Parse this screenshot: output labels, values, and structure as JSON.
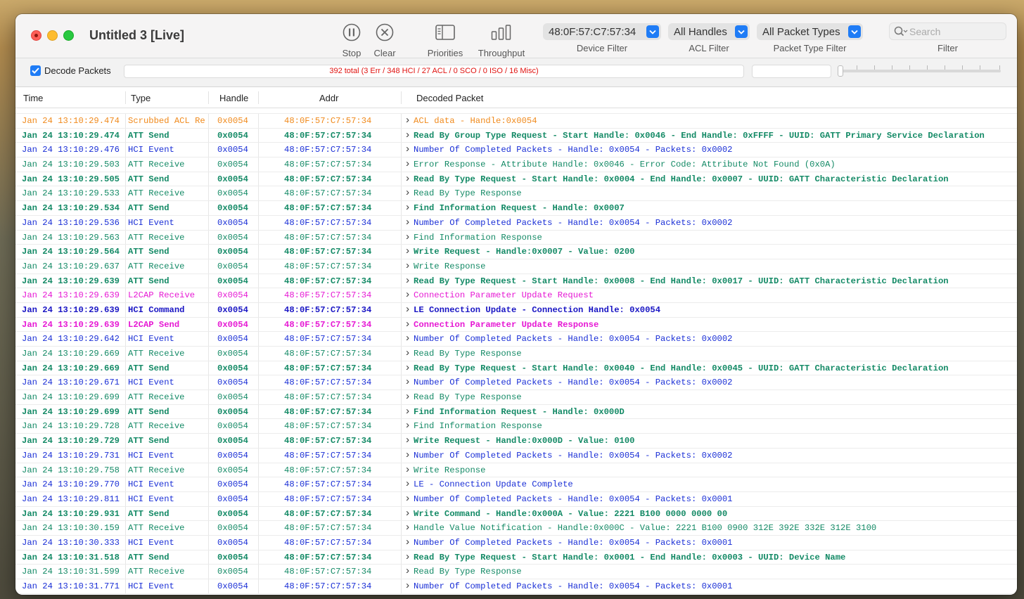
{
  "window": {
    "title": "Untitled 3 [Live]"
  },
  "toolbar": {
    "stop_label": "Stop",
    "clear_label": "Clear",
    "priorities_label": "Priorities",
    "throughput_label": "Throughput",
    "device_filter_value": "48:0F:57:C7:57:34",
    "device_filter_label": "Device Filter",
    "acl_filter_value": "All Handles",
    "acl_filter_label": "ACL Filter",
    "packet_type_value": "All Packet Types",
    "packet_type_label": "Packet Type Filter",
    "search_placeholder": "Search",
    "filter_label": "Filter"
  },
  "filterbar": {
    "decode_label": "Decode Packets",
    "decode_checked": true,
    "summary": "392 total (3 Err / 348 HCI / 27 ACL / 0 SCO / 0 ISO / 16 Misc)"
  },
  "columns": {
    "time": "Time",
    "type": "Type",
    "handle": "Handle",
    "addr": "Addr",
    "decoded": "Decoded Packet"
  },
  "colors": {
    "green": "#148a66",
    "blue": "#1a2fd6",
    "orange": "#f08a1c",
    "magenta": "#e619d4",
    "navy": "#1a16c4",
    "red": "#e0120f"
  },
  "rows": [
    {
      "time": "Jan 24 13:10:29.474",
      "type": "Scrubbed ACL Re",
      "handle": "0x0054",
      "addr": "48:0F:57:C7:57:34",
      "decoded": "ACL data - Handle:0x0054",
      "color": "orange",
      "bold": false
    },
    {
      "time": "Jan 24 13:10:29.474",
      "type": "ATT Send",
      "handle": "0x0054",
      "addr": "48:0F:57:C7:57:34",
      "decoded": "Read By Group Type Request - Start Handle: 0x0046 - End Handle: 0xFFFF - UUID: GATT Primary Service Declaration",
      "color": "green",
      "bold": true
    },
    {
      "time": "Jan 24 13:10:29.476",
      "type": "HCI Event",
      "handle": "0x0054",
      "addr": "48:0F:57:C7:57:34",
      "decoded": "Number Of Completed Packets - Handle: 0x0054 - Packets: 0x0002",
      "color": "blue",
      "bold": false
    },
    {
      "time": "Jan 24 13:10:29.503",
      "type": "ATT Receive",
      "handle": "0x0054",
      "addr": "48:0F:57:C7:57:34",
      "decoded": "Error Response - Attribute Handle: 0x0046 - Error Code: Attribute Not Found (0x0A)",
      "color": "green",
      "bold": false
    },
    {
      "time": "Jan 24 13:10:29.505",
      "type": "ATT Send",
      "handle": "0x0054",
      "addr": "48:0F:57:C7:57:34",
      "decoded": "Read By Type Request - Start Handle: 0x0004 - End Handle: 0x0007 - UUID: GATT Characteristic Declaration",
      "color": "green",
      "bold": true
    },
    {
      "time": "Jan 24 13:10:29.533",
      "type": "ATT Receive",
      "handle": "0x0054",
      "addr": "48:0F:57:C7:57:34",
      "decoded": "Read By Type Response",
      "color": "green",
      "bold": false
    },
    {
      "time": "Jan 24 13:10:29.534",
      "type": "ATT Send",
      "handle": "0x0054",
      "addr": "48:0F:57:C7:57:34",
      "decoded": "Find Information Request - Handle: 0x0007",
      "color": "green",
      "bold": true
    },
    {
      "time": "Jan 24 13:10:29.536",
      "type": "HCI Event",
      "handle": "0x0054",
      "addr": "48:0F:57:C7:57:34",
      "decoded": "Number Of Completed Packets - Handle: 0x0054 - Packets: 0x0002",
      "color": "blue",
      "bold": false
    },
    {
      "time": "Jan 24 13:10:29.563",
      "type": "ATT Receive",
      "handle": "0x0054",
      "addr": "48:0F:57:C7:57:34",
      "decoded": "Find Information Response",
      "color": "green",
      "bold": false
    },
    {
      "time": "Jan 24 13:10:29.564",
      "type": "ATT Send",
      "handle": "0x0054",
      "addr": "48:0F:57:C7:57:34",
      "decoded": "Write Request - Handle:0x0007 - Value: 0200",
      "color": "green",
      "bold": true
    },
    {
      "time": "Jan 24 13:10:29.637",
      "type": "ATT Receive",
      "handle": "0x0054",
      "addr": "48:0F:57:C7:57:34",
      "decoded": "Write Response",
      "color": "green",
      "bold": false
    },
    {
      "time": "Jan 24 13:10:29.639",
      "type": "ATT Send",
      "handle": "0x0054",
      "addr": "48:0F:57:C7:57:34",
      "decoded": "Read By Type Request - Start Handle: 0x0008 - End Handle: 0x0017 - UUID: GATT Characteristic Declaration",
      "color": "green",
      "bold": true
    },
    {
      "time": "Jan 24 13:10:29.639",
      "type": "L2CAP Receive",
      "handle": "0x0054",
      "addr": "48:0F:57:C7:57:34",
      "decoded": "Connection Parameter Update Request",
      "color": "magenta",
      "bold": false
    },
    {
      "time": "Jan 24 13:10:29.639",
      "type": "HCI Command",
      "handle": "0x0054",
      "addr": "48:0F:57:C7:57:34",
      "decoded": "LE Connection Update - Connection Handle: 0x0054",
      "color": "navy",
      "bold": true
    },
    {
      "time": "Jan 24 13:10:29.639",
      "type": "L2CAP Send",
      "handle": "0x0054",
      "addr": "48:0F:57:C7:57:34",
      "decoded": "Connection Parameter Update Response",
      "color": "magenta",
      "bold": true
    },
    {
      "time": "Jan 24 13:10:29.642",
      "type": "HCI Event",
      "handle": "0x0054",
      "addr": "48:0F:57:C7:57:34",
      "decoded": "Number Of Completed Packets - Handle: 0x0054 - Packets: 0x0002",
      "color": "blue",
      "bold": false
    },
    {
      "time": "Jan 24 13:10:29.669",
      "type": "ATT Receive",
      "handle": "0x0054",
      "addr": "48:0F:57:C7:57:34",
      "decoded": "Read By Type Response",
      "color": "green",
      "bold": false
    },
    {
      "time": "Jan 24 13:10:29.669",
      "type": "ATT Send",
      "handle": "0x0054",
      "addr": "48:0F:57:C7:57:34",
      "decoded": "Read By Type Request - Start Handle: 0x0040 - End Handle: 0x0045 - UUID: GATT Characteristic Declaration",
      "color": "green",
      "bold": true
    },
    {
      "time": "Jan 24 13:10:29.671",
      "type": "HCI Event",
      "handle": "0x0054",
      "addr": "48:0F:57:C7:57:34",
      "decoded": "Number Of Completed Packets - Handle: 0x0054 - Packets: 0x0002",
      "color": "blue",
      "bold": false
    },
    {
      "time": "Jan 24 13:10:29.699",
      "type": "ATT Receive",
      "handle": "0x0054",
      "addr": "48:0F:57:C7:57:34",
      "decoded": "Read By Type Response",
      "color": "green",
      "bold": false
    },
    {
      "time": "Jan 24 13:10:29.699",
      "type": "ATT Send",
      "handle": "0x0054",
      "addr": "48:0F:57:C7:57:34",
      "decoded": "Find Information Request - Handle: 0x000D",
      "color": "green",
      "bold": true
    },
    {
      "time": "Jan 24 13:10:29.728",
      "type": "ATT Receive",
      "handle": "0x0054",
      "addr": "48:0F:57:C7:57:34",
      "decoded": "Find Information Response",
      "color": "green",
      "bold": false
    },
    {
      "time": "Jan 24 13:10:29.729",
      "type": "ATT Send",
      "handle": "0x0054",
      "addr": "48:0F:57:C7:57:34",
      "decoded": "Write Request - Handle:0x000D - Value: 0100",
      "color": "green",
      "bold": true
    },
    {
      "time": "Jan 24 13:10:29.731",
      "type": "HCI Event",
      "handle": "0x0054",
      "addr": "48:0F:57:C7:57:34",
      "decoded": "Number Of Completed Packets - Handle: 0x0054 - Packets: 0x0002",
      "color": "blue",
      "bold": false
    },
    {
      "time": "Jan 24 13:10:29.758",
      "type": "ATT Receive",
      "handle": "0x0054",
      "addr": "48:0F:57:C7:57:34",
      "decoded": "Write Response",
      "color": "green",
      "bold": false
    },
    {
      "time": "Jan 24 13:10:29.770",
      "type": "HCI Event",
      "handle": "0x0054",
      "addr": "48:0F:57:C7:57:34",
      "decoded": "LE - Connection Update Complete",
      "color": "blue",
      "bold": false
    },
    {
      "time": "Jan 24 13:10:29.811",
      "type": "HCI Event",
      "handle": "0x0054",
      "addr": "48:0F:57:C7:57:34",
      "decoded": "Number Of Completed Packets - Handle: 0x0054 - Packets: 0x0001",
      "color": "blue",
      "bold": false
    },
    {
      "time": "Jan 24 13:10:29.931",
      "type": "ATT Send",
      "handle": "0x0054",
      "addr": "48:0F:57:C7:57:34",
      "decoded": "Write Command - Handle:0x000A - Value: 2221 B100 0000 0000 00",
      "color": "green",
      "bold": true
    },
    {
      "time": "Jan 24 13:10:30.159",
      "type": "ATT Receive",
      "handle": "0x0054",
      "addr": "48:0F:57:C7:57:34",
      "decoded": "Handle Value Notification - Handle:0x000C - Value: 2221 B100 0900 312E 392E 332E 312E 3100",
      "color": "green",
      "bold": false
    },
    {
      "time": "Jan 24 13:10:30.333",
      "type": "HCI Event",
      "handle": "0x0054",
      "addr": "48:0F:57:C7:57:34",
      "decoded": "Number Of Completed Packets - Handle: 0x0054 - Packets: 0x0001",
      "color": "blue",
      "bold": false
    },
    {
      "time": "Jan 24 13:10:31.518",
      "type": "ATT Send",
      "handle": "0x0054",
      "addr": "48:0F:57:C7:57:34",
      "decoded": "Read By Type Request - Start Handle: 0x0001 - End Handle: 0x0003 - UUID: Device Name",
      "color": "green",
      "bold": true
    },
    {
      "time": "Jan 24 13:10:31.599",
      "type": "ATT Receive",
      "handle": "0x0054",
      "addr": "48:0F:57:C7:57:34",
      "decoded": "Read By Type Response",
      "color": "green",
      "bold": false
    },
    {
      "time": "Jan 24 13:10:31.771",
      "type": "HCI Event",
      "handle": "0x0054",
      "addr": "48:0F:57:C7:57:34",
      "decoded": "Number Of Completed Packets - Handle: 0x0054 - Packets: 0x0001",
      "color": "blue",
      "bold": false
    }
  ]
}
